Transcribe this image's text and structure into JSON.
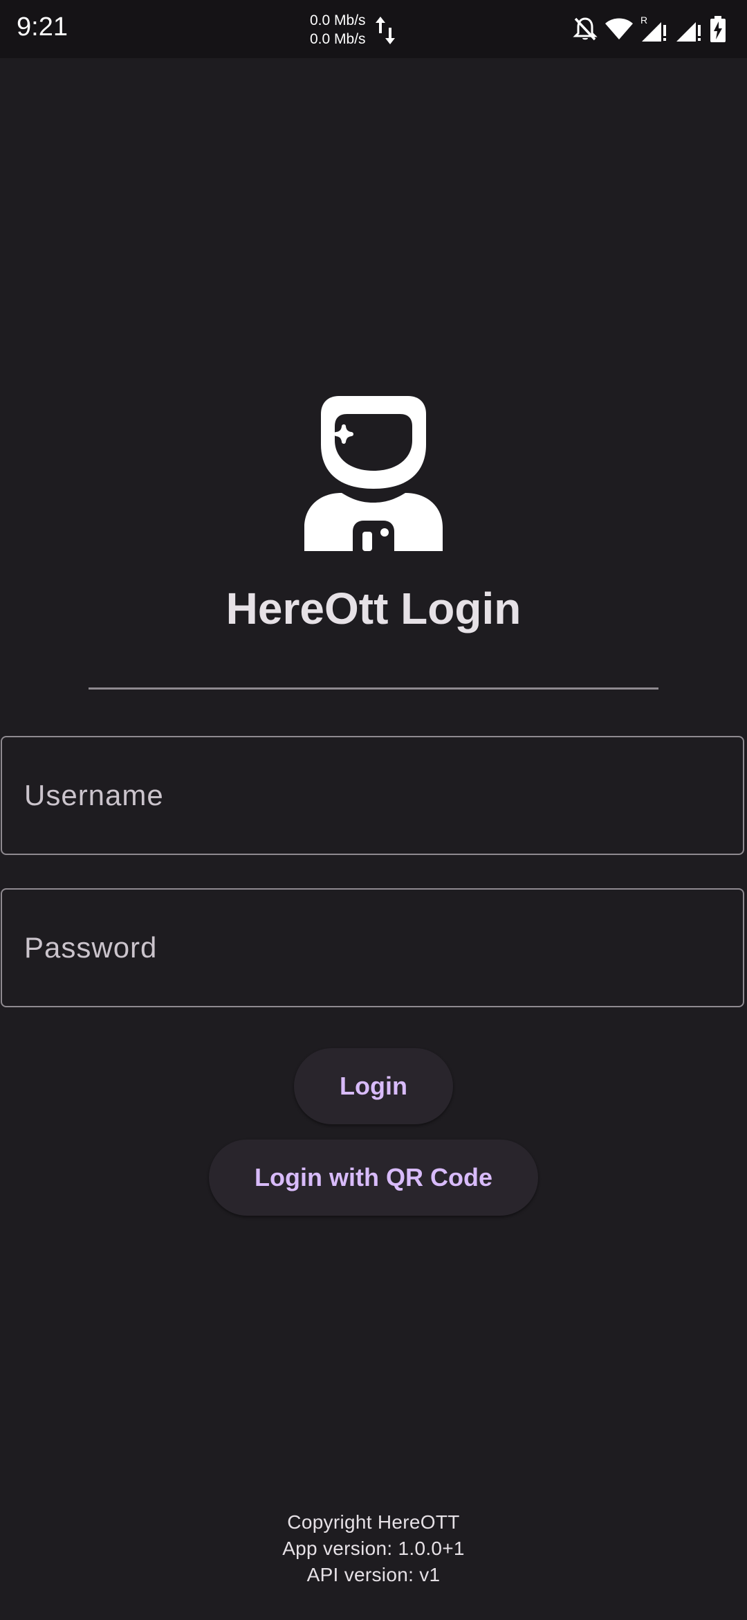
{
  "status_bar": {
    "time": "9:21",
    "net_up": "0.0 Mb/s",
    "net_down": "0.0 Mb/s",
    "roaming_indicator": "R",
    "icons": [
      "data-transfer-icon",
      "notifications-off-icon",
      "wifi-icon",
      "signal-roaming-icon",
      "signal-icon",
      "battery-charging-icon"
    ]
  },
  "login": {
    "logo_icon": "astronaut-icon",
    "title": "HereOtt Login",
    "username_placeholder": "Username",
    "username_value": "",
    "password_placeholder": "Password",
    "password_value": "",
    "login_button": "Login",
    "qr_button": "Login with QR Code"
  },
  "footer": {
    "copyright": "Copyright HereOTT",
    "app_version": "App version: 1.0.0+1",
    "api_version": "API version: v1"
  },
  "colors": {
    "background": "#1e1c20",
    "status_bar": "#151316",
    "accent": "#d8bbfa",
    "button_surface": "#29252c",
    "outline": "#8f8a90",
    "text": "#e6e1e6"
  }
}
